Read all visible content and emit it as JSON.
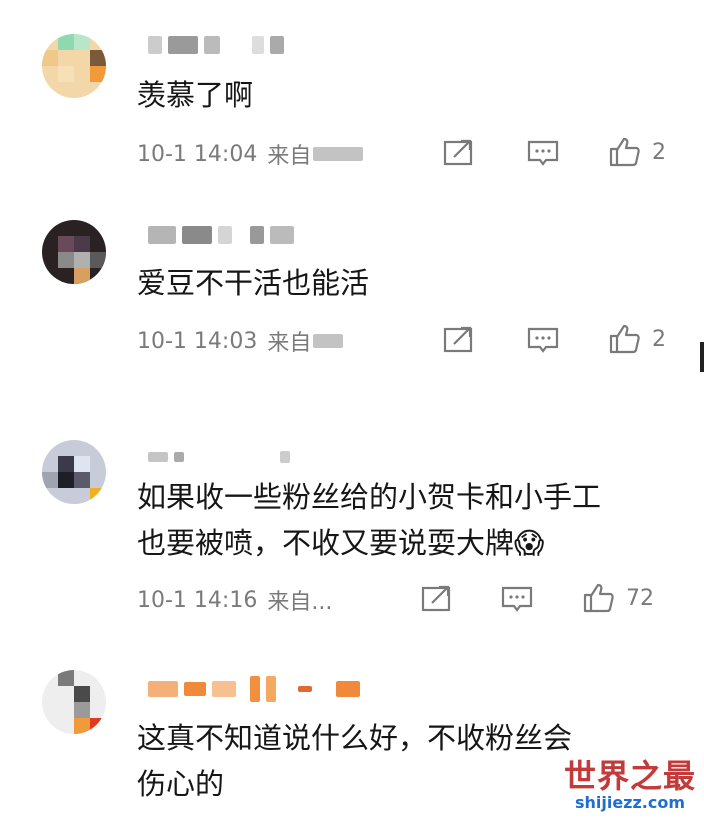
{
  "comments": [
    {
      "text_lines": [
        "羡慕了啊"
      ],
      "time": "10-1 14:04",
      "source": "来自",
      "likes": "2"
    },
    {
      "text_lines": [
        "爱豆不干活也能活"
      ],
      "time": "10-1 14:03",
      "source": "来自",
      "likes": "2"
    },
    {
      "text_lines": [
        "如果收一些粉丝给的小贺卡和小手工",
        "也要被喷，不收又要说耍大牌😱"
      ],
      "time": "10-1 14:16",
      "source": "来自...",
      "likes": "72"
    },
    {
      "text_lines": [
        "这真不知道说什么好，不收粉丝会",
        "伤心的"
      ]
    }
  ],
  "icons": {
    "share": "share-icon",
    "reply": "comment-icon",
    "like": "thumbs-up-icon"
  },
  "watermark": {
    "title": "世界之最",
    "url": "shijiezz.com"
  },
  "colors": {
    "meta_gray": "#7a7a7a",
    "watermark_red": "#c23a3a",
    "watermark_blue": "#1e6fd0"
  }
}
